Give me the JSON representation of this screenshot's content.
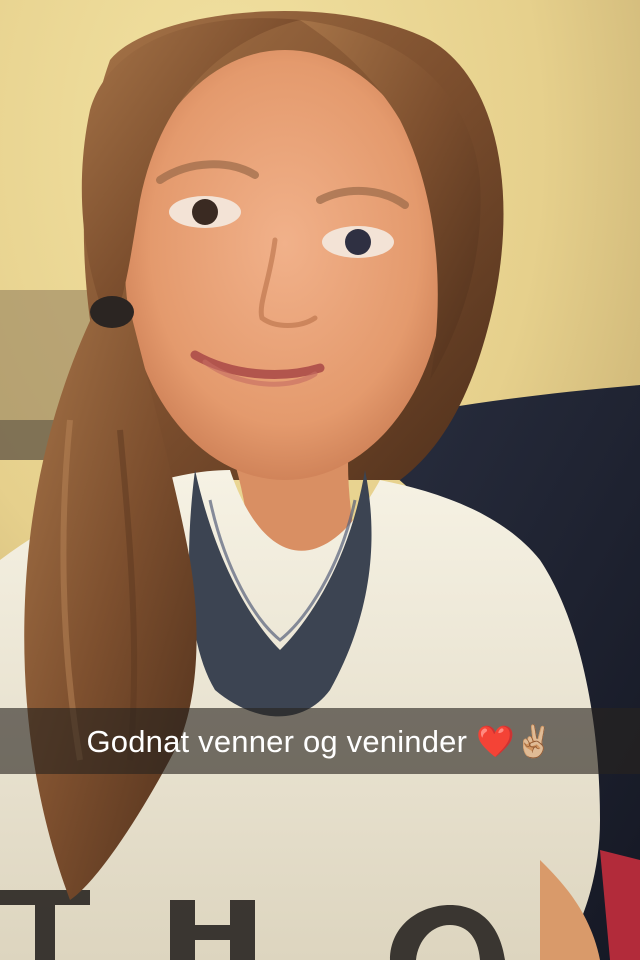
{
  "snap": {
    "caption": "Godnat venner og veninder ❤️✌🏼"
  },
  "icons": {
    "heart": "heart-emoji-icon",
    "peace": "victory-hand-emoji-icon"
  },
  "colors": {
    "wall": "#e6d38f",
    "shadow_wall": "#b8a06a",
    "hair": "#8a5a35",
    "skin": "#e9a379",
    "shirt": "#f1ecdc",
    "necklace": "#3c4452",
    "sofa": "#1d2130",
    "caption_bar": "#28241e"
  }
}
